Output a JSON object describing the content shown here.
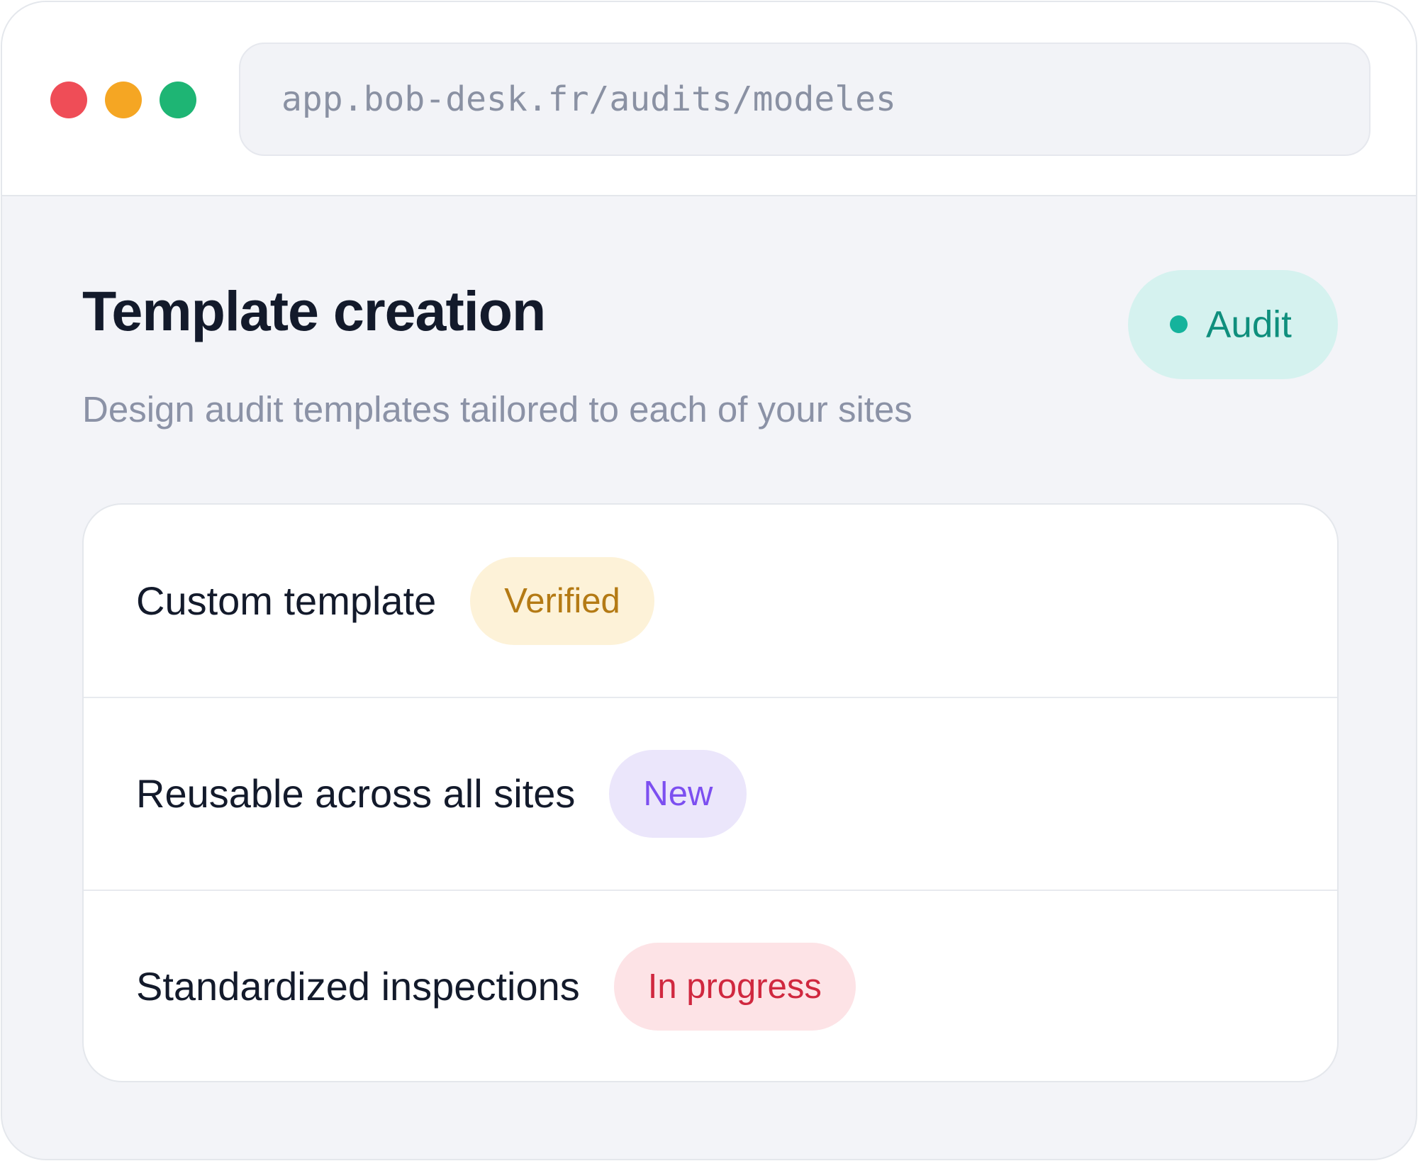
{
  "browser": {
    "url": "app.bob-desk.fr/audits/modeles",
    "window_controls": [
      "close-dot",
      "minimize-dot",
      "maximize-dot"
    ]
  },
  "header": {
    "title": "Template creation",
    "subtitle": "Design audit templates tailored to each of your sites",
    "badge": "Audit"
  },
  "features": [
    {
      "label": "Custom template",
      "status": "Verified"
    },
    {
      "label": "Reusable across all sites",
      "status": "New"
    },
    {
      "label": "Standardized inspections",
      "status": "In progress"
    }
  ],
  "colors": {
    "close": "#ef4d57",
    "minimize": "#f5a623",
    "maximize": "#1eb574",
    "accent_teal": "#15b39c",
    "verified": "#b47a14",
    "new": "#7c4ff0",
    "in_progress": "#d0283f"
  }
}
